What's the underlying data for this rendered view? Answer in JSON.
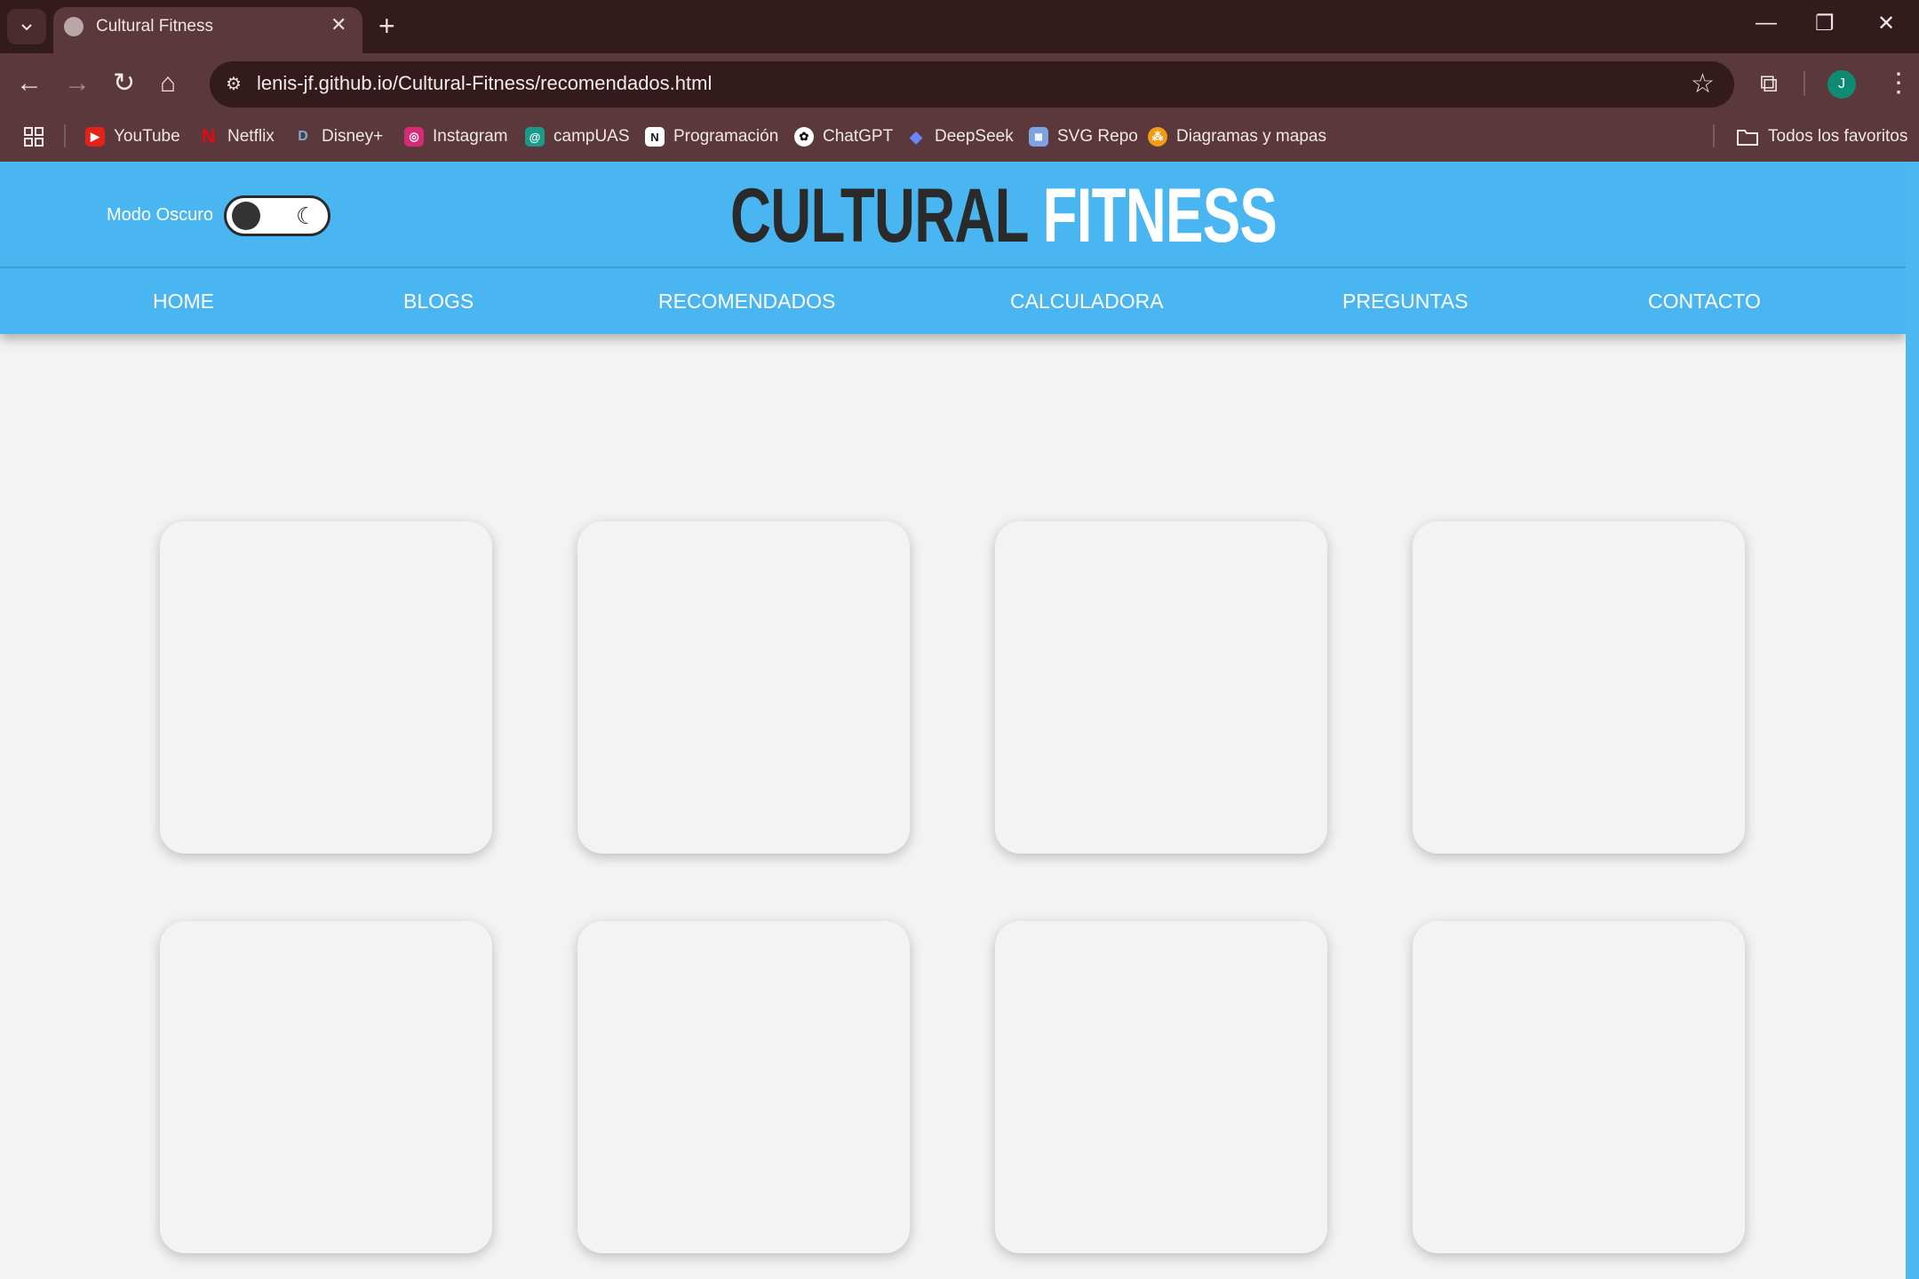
{
  "browser": {
    "tab_title": "Cultural Fitness",
    "url": "lenis-jf.github.io/Cultural-Fitness/recomendados.html",
    "avatar_letter": "J",
    "bookmarks": [
      {
        "label": "YouTube",
        "icon": "youtube-icon",
        "color": "#e62117"
      },
      {
        "label": "Netflix",
        "icon": "netflix-icon",
        "color": "#e50914"
      },
      {
        "label": "Disney+",
        "icon": "disney-icon",
        "color": "#1b4f8a"
      },
      {
        "label": "Instagram",
        "icon": "instagram-icon",
        "color": "#d62976"
      },
      {
        "label": "campUAS",
        "icon": "campuas-icon",
        "color": "#1a9b8a"
      },
      {
        "label": "Programación",
        "icon": "notion-icon",
        "color": "#ffffff"
      },
      {
        "label": "ChatGPT",
        "icon": "chatgpt-icon",
        "color": "#ffffff"
      },
      {
        "label": "DeepSeek",
        "icon": "deepseek-icon",
        "color": "#4d6bfe"
      },
      {
        "label": "SVG Repo",
        "icon": "svgrepo-icon",
        "color": "#7fa3e0"
      },
      {
        "label": "Diagramas y mapas",
        "icon": "diagrams-icon",
        "color": "#f39c12"
      }
    ],
    "all_bookmarks": "Todos los favoritos"
  },
  "site": {
    "dark_mode_label": "Modo Oscuro",
    "dark_mode_on": false,
    "brand_word1": "CULTURAL",
    "brand_word2": "FITNESS",
    "nav": [
      "HOME",
      "BLOGS",
      "RECOMENDADOS",
      "CALCULADORA",
      "PREGUNTAS",
      "CONTACTO"
    ],
    "colors": {
      "header": "#49b6f1",
      "background": "#f3f3f3",
      "brand_dark": "#2a2a2a"
    }
  }
}
